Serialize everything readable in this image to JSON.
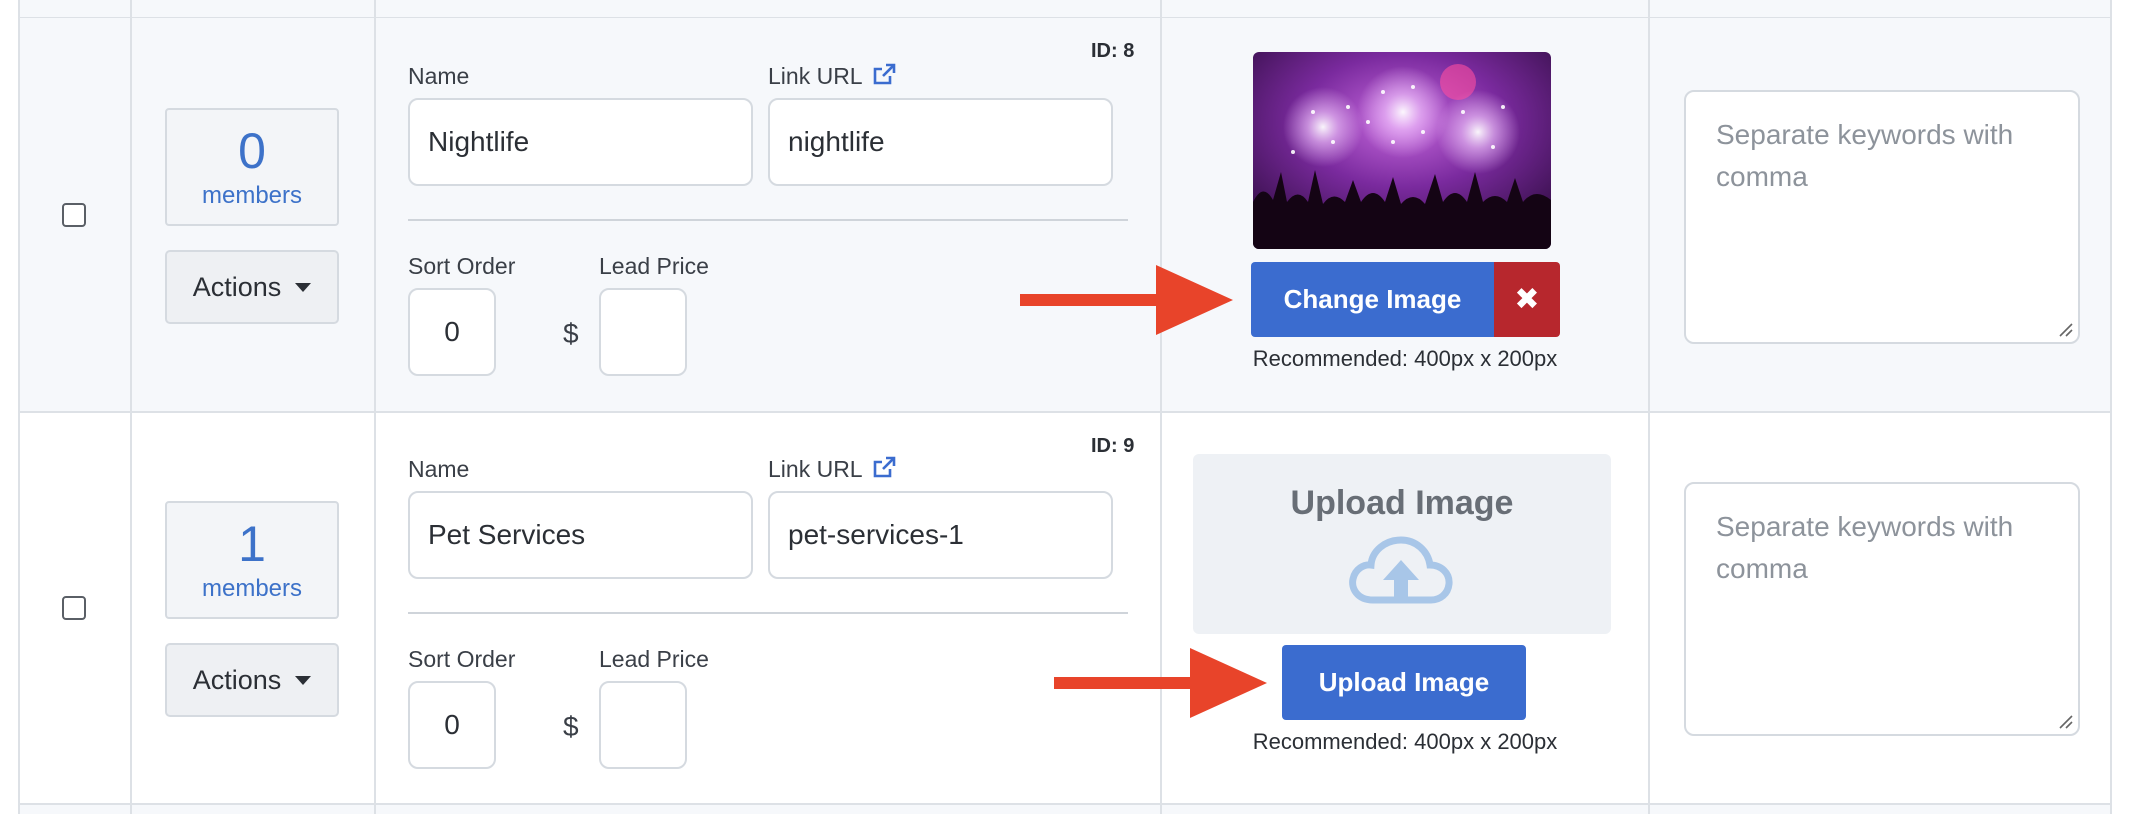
{
  "rows": [
    {
      "id_label": "ID: 8",
      "members_count": "0",
      "members_label": "members",
      "actions_label": "Actions",
      "name_label": "Name",
      "name_value": "Nightlife",
      "link_label": "Link URL",
      "link_value": "nightlife",
      "sort_label": "Sort Order",
      "sort_value": "0",
      "lead_label": "Lead Price",
      "lead_value": "",
      "currency": "$",
      "change_image_label": "Change Image",
      "remove_image_label": "✖",
      "recommended": "Recommended: 400px x 200px",
      "keywords_placeholder": "Separate keywords with comma",
      "image_icon": "concert-fireworks-image"
    },
    {
      "id_label": "ID: 9",
      "members_count": "1",
      "members_label": "members",
      "actions_label": "Actions",
      "name_label": "Name",
      "name_value": "Pet Services",
      "link_label": "Link URL",
      "link_value": "pet-services-1",
      "sort_label": "Sort Order",
      "sort_value": "0",
      "lead_label": "Lead Price",
      "lead_value": "",
      "currency": "$",
      "upload_box_label": "Upload Image",
      "upload_button_label": "Upload Image",
      "recommended": "Recommended: 400px x 200px",
      "keywords_placeholder": "Separate keywords with comma",
      "upload_icon": "cloud-upload-icon"
    }
  ],
  "colors": {
    "primary": "#3b6ccf",
    "danger": "#b7272d",
    "annotation_arrow": "#e8442a",
    "members_text": "#3d72c9"
  }
}
